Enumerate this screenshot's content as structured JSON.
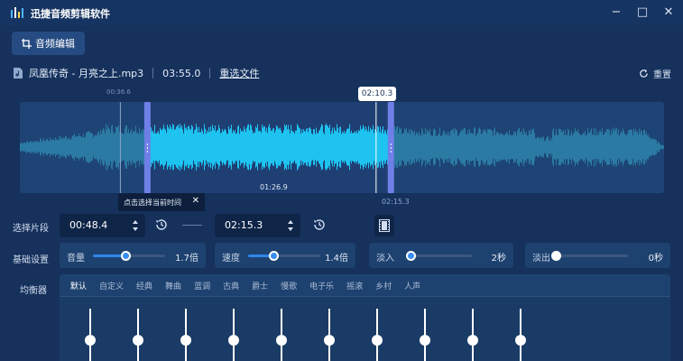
{
  "app": {
    "title": "迅捷音频剪辑软件",
    "minimize_glyph": "−",
    "maximize_glyph": "□",
    "close_glyph": "✕"
  },
  "toolbar": {
    "edit_label": "音频编辑"
  },
  "file": {
    "name": "凤凰传奇 - 月亮之上.mp3",
    "duration": "03:55.0",
    "reselect_label": "重选文件",
    "reset_label": "重置"
  },
  "waveform": {
    "start_marker_label": "00:36.6",
    "cursor_time": "02:10.3",
    "selection_duration": "01:26.9",
    "selection_end_label": "02:15.3",
    "tooltip": "点击选择当前时间",
    "tooltip_close": "✕",
    "selection_start_fraction": 0.198,
    "selection_end_fraction": 0.576,
    "cursor_fraction": 0.553,
    "marker_fraction": 0.156
  },
  "segment": {
    "label": "选择片段",
    "start_value": "00:48.4",
    "end_value": "02:15.3"
  },
  "basic": {
    "label": "基础设置",
    "volume": {
      "label": "音量",
      "value": "1.7倍",
      "level": 0.45
    },
    "speed": {
      "label": "速度",
      "value": "1.4倍",
      "level": 0.35
    },
    "fade_in": {
      "label": "淡入",
      "value": "2秒",
      "level": 0.05
    },
    "fade_out": {
      "label": "淡出",
      "value": "0秒",
      "level": 0.0
    }
  },
  "equalizer": {
    "label": "均衡器",
    "tabs": [
      "默认",
      "自定义",
      "经典",
      "舞曲",
      "蓝调",
      "古典",
      "爵士",
      "慢歌",
      "电子乐",
      "摇滚",
      "乡村",
      "人声"
    ],
    "active_tab": 0,
    "band_count": 10
  },
  "colors": {
    "accent": "#2d86e8",
    "wave_selected": "#1ec3f0",
    "wave_unselected": "#2b7aa3",
    "handle": "#6f7fe8"
  }
}
